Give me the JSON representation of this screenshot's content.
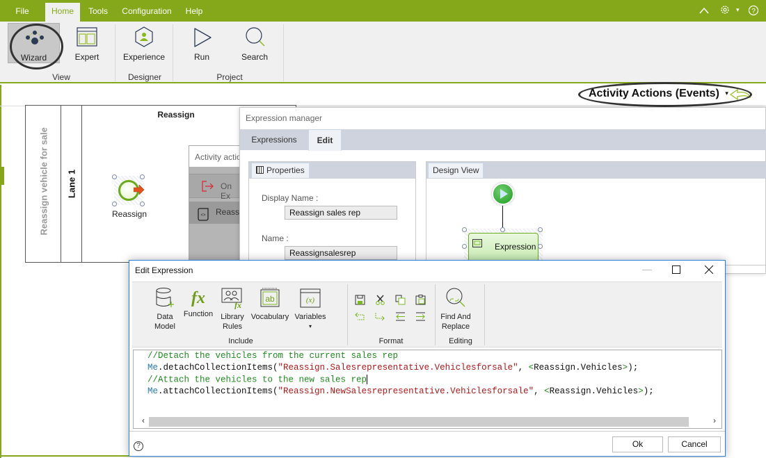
{
  "menubar": {
    "items": [
      "File",
      "Home",
      "Tools",
      "Configuration",
      "Help"
    ],
    "active": "Home",
    "icons": [
      "collapse-ribbon-icon",
      "gear-icon",
      "dropdown-caret-icon",
      "help-icon"
    ]
  },
  "ribbon": {
    "buttons": [
      {
        "label": "Wizard",
        "icon": "wizard-icon",
        "selected": true
      },
      {
        "label": "Expert",
        "icon": "expert-layout-icon"
      },
      {
        "label": "Experience",
        "icon": "experience-icon"
      },
      {
        "label": "Run",
        "icon": "play-icon"
      },
      {
        "label": "Search",
        "icon": "search-icon"
      }
    ],
    "groups": [
      "View",
      "Designer",
      "Project"
    ]
  },
  "canvas": {
    "activity_actions_label": "Activity Actions (Events)",
    "pool_name": "Reassign vehicle for sale",
    "lane_name": "Lane 1",
    "pool_title": "Reassign",
    "start_node_label": "Reassign"
  },
  "activity_actions_dialog": {
    "title": "Activity actio",
    "rows": [
      "On Ex",
      "Reassig"
    ]
  },
  "expression_manager": {
    "title": "Expression manager",
    "tabs": [
      "Expressions",
      "Edit"
    ],
    "active_tab": "Edit",
    "properties_tab": "Properties",
    "design_view_tab": "Design View",
    "display_name_label": "Display Name :",
    "display_name_value": "Reassign sales rep",
    "name_label": "Name :",
    "name_value": "Reassignsalesrep",
    "expression_node_label": "Expression"
  },
  "edit_expression": {
    "title": "Edit Expression",
    "window_controls": [
      "minimize",
      "maximize",
      "close"
    ],
    "include_buttons": [
      {
        "label1": "Data",
        "label2": "Model",
        "icon": "data-model-icon"
      },
      {
        "label1": "Function",
        "label2": "",
        "icon": "function-icon"
      },
      {
        "label1": "Library",
        "label2": "Rules",
        "icon": "library-rules-icon"
      },
      {
        "label1": "Vocabulary",
        "label2": "",
        "icon": "vocabulary-icon"
      },
      {
        "label1": "Variables",
        "label2": "▾",
        "icon": "variables-icon"
      }
    ],
    "groups": [
      "Include",
      "Format",
      "Editing"
    ],
    "find_replace": {
      "label1": "Find And",
      "label2": "Replace"
    },
    "code": {
      "line1": "//Detach the vehicles from the current sales rep",
      "line2_me": "Me",
      "line2_fn": ".detachCollectionItems(",
      "line2_str": "\"Reassign.Salesrepresentative.Vehiclesforsale\"",
      "line2_sep": ", ",
      "line2_ref": "Reassign.Vehicles",
      "line2_end": ");",
      "line3": "//Attach the vehicles to the new sales rep",
      "line4_me": "Me",
      "line4_fn": ".attachCollectionItems(",
      "line4_str": "\"Reassign.NewSalesrepresentative.Vehiclesforsale\"",
      "line4_sep": ", ",
      "line4_ref": "Reassign.Vehicles",
      "line4_end": ");"
    },
    "ok_label": "Ok",
    "cancel_label": "Cancel",
    "help_symbol": "?"
  }
}
